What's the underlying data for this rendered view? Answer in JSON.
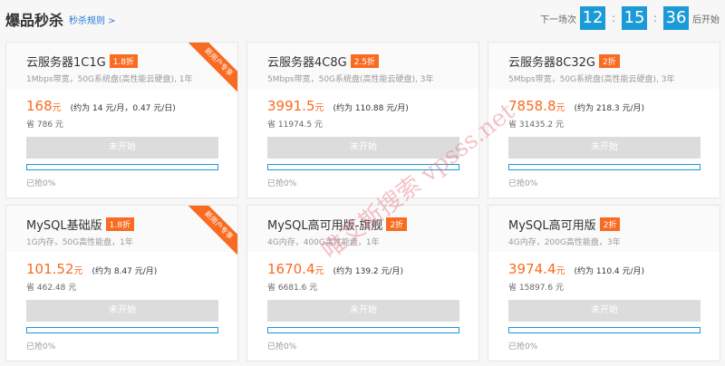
{
  "header": {
    "title": "爆品秒杀",
    "rule_link": "秒杀规则 >",
    "next_label": "下一场次",
    "hours": "12",
    "minutes": "15",
    "seconds": "36",
    "start_label": "后开始",
    "sep": ":"
  },
  "cards": [
    {
      "name": "云服务器1C1G",
      "discount": "1.8折",
      "spec": "1Mbps带宽，50G系统盘(高性能云硬盘), 1年",
      "price": "168",
      "unit": "元",
      "approx": "(约为 14 元/月，0.47 元/日)",
      "save": "省 786 元",
      "button": "未开始",
      "progress": 0,
      "sold": "已抢0%",
      "ribbon": "新用户专享"
    },
    {
      "name": "云服务器4C8G",
      "discount": "2.5折",
      "spec": "5Mbps带宽，50G系统盘(高性能云硬盘), 3年",
      "price": "3991.5",
      "unit": "元",
      "approx": "(约为 110.88 元/月)",
      "save": "省 11974.5 元",
      "button": "未开始",
      "progress": 0,
      "sold": "已抢0%",
      "ribbon": ""
    },
    {
      "name": "云服务器8C32G",
      "discount": "2折",
      "spec": "5Mbps带宽，50G系统盘(高性能云硬盘), 3年",
      "price": "7858.8",
      "unit": "元",
      "approx": "(约为 218.3 元/月)",
      "save": "省 31435.2 元",
      "button": "未开始",
      "progress": 0,
      "sold": "已抢0%",
      "ribbon": ""
    },
    {
      "name": "MySQL基础版",
      "discount": "1.8折",
      "spec": "1G内存，50G高性能盘，1年",
      "price": "101.52",
      "unit": "元",
      "approx": "(约为 8.47 元/月)",
      "save": "省 462.48 元",
      "button": "未开始",
      "progress": 0,
      "sold": "已抢0%",
      "ribbon": "新用户专享"
    },
    {
      "name": "MySQL高可用版-旗舰",
      "discount": "2折",
      "spec": "4G内存，400G高性能盘，1年",
      "price": "1670.4",
      "unit": "元",
      "approx": "(约为 139.2 元/月)",
      "save": "省 6681.6 元",
      "button": "未开始",
      "progress": 0,
      "sold": "已抢0%",
      "ribbon": ""
    },
    {
      "name": "MySQL高可用版",
      "discount": "2折",
      "spec": "4G内存，200G高性能盘，3年",
      "price": "3974.4",
      "unit": "元",
      "approx": "(约为 110.4 元/月)",
      "save": "省 15897.6 元",
      "button": "未开始",
      "progress": 0,
      "sold": "已抢0%",
      "ribbon": ""
    }
  ],
  "watermark": "唯艾斯搜索 vpsss.net"
}
